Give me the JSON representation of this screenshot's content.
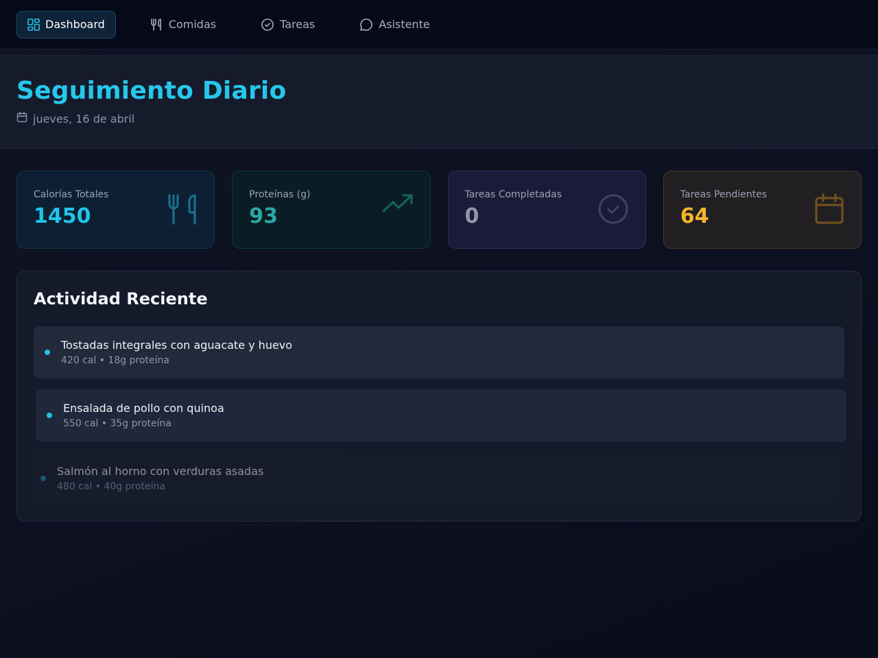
{
  "nav": {
    "items": [
      {
        "label": "Dashboard",
        "icon": "dashboard-grid-icon",
        "active": true
      },
      {
        "label": "Comidas",
        "icon": "utensils-icon",
        "active": false
      },
      {
        "label": "Tareas",
        "icon": "check-circle-icon",
        "active": false
      },
      {
        "label": "Asistente",
        "icon": "chat-bubble-icon",
        "active": false
      }
    ]
  },
  "header": {
    "title": "Seguimiento Diario",
    "date": "jueves, 16 de abril",
    "date_icon": "calendar-icon"
  },
  "stats": [
    {
      "label": "Calorías Totales",
      "value": "1450",
      "icon": "utensils-icon",
      "color": "#21c3ea"
    },
    {
      "label": "Proteínas (g)",
      "value": "93",
      "icon": "trending-up-icon",
      "color": "#2aa7a4"
    },
    {
      "label": "Tareas Completadas",
      "value": "0",
      "icon": "check-circle-icon",
      "color": "#8f96ad"
    },
    {
      "label": "Tareas Pendientes",
      "value": "64",
      "icon": "calendar-icon",
      "color": "#f4b52a"
    }
  ],
  "activity": {
    "title": "Actividad Reciente",
    "items": [
      {
        "name": "Tostadas integrales con aguacate y huevo",
        "meta": "420 cal • 18g proteína"
      },
      {
        "name": "Ensalada de pollo con quinoa",
        "meta": "550 cal • 35g proteína"
      },
      {
        "name": "Salmón al horno con verduras asadas",
        "meta": "480 cal • 40g proteína"
      }
    ]
  },
  "colors": {
    "accent": "#25c7ea",
    "background": "#0f1322",
    "nav_background": "#060a18"
  }
}
